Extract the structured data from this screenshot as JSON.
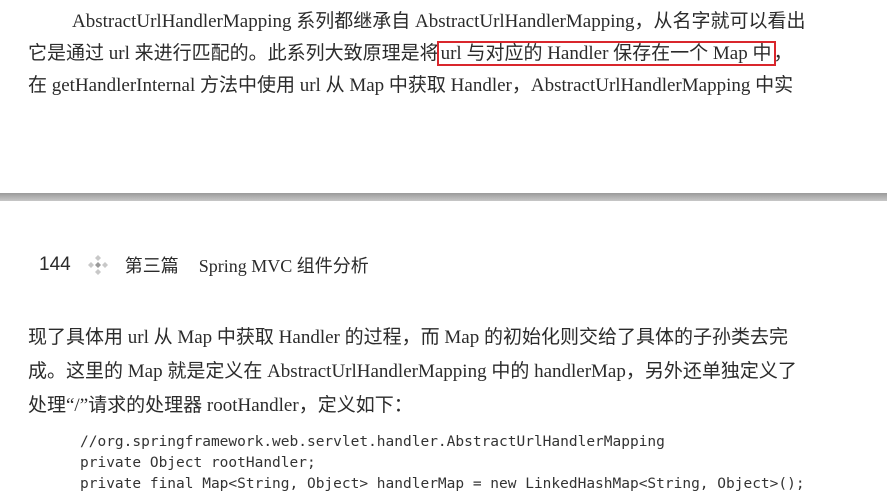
{
  "top": {
    "line1": "AbstractUrlHandlerMapping 系列都继承自 AbstractUrlHandlerMapping，从名字就可以看出",
    "line2_before": "它是通过 url 来进行匹配的。此系列大致原理是将",
    "line2_highlight": "url 与对应的 Handler 保存在一个 Map 中",
    "line2_after": "，",
    "line3": "在 getHandlerInternal 方法中使用 url 从 Map 中获取 Handler，AbstractUrlHandlerMapping 中实"
  },
  "header": {
    "page_number": "144",
    "part": "第三篇",
    "title": "Spring MVC 组件分析"
  },
  "body": {
    "line1": "现了具体用 url 从 Map 中获取 Handler 的过程，而 Map 的初始化则交给了具体的子孙类去完",
    "line2": "成。这里的 Map 就是定义在 AbstractUrlHandlerMapping 中的 handlerMap，另外还单独定义了",
    "line3": "处理“/”请求的处理器 rootHandler，定义如下："
  },
  "code": [
    "//org.springframework.web.servlet.handler.AbstractUrlHandlerMapping",
    "private Object rootHandler;",
    "private final Map<String, Object> handlerMap = new LinkedHashMap<String, Object>();"
  ],
  "colors": {
    "highlight_border": "#d9262c",
    "divider": "#b0b0b0"
  },
  "icons": {
    "ornament": "four-diamond-ornament-icon"
  }
}
